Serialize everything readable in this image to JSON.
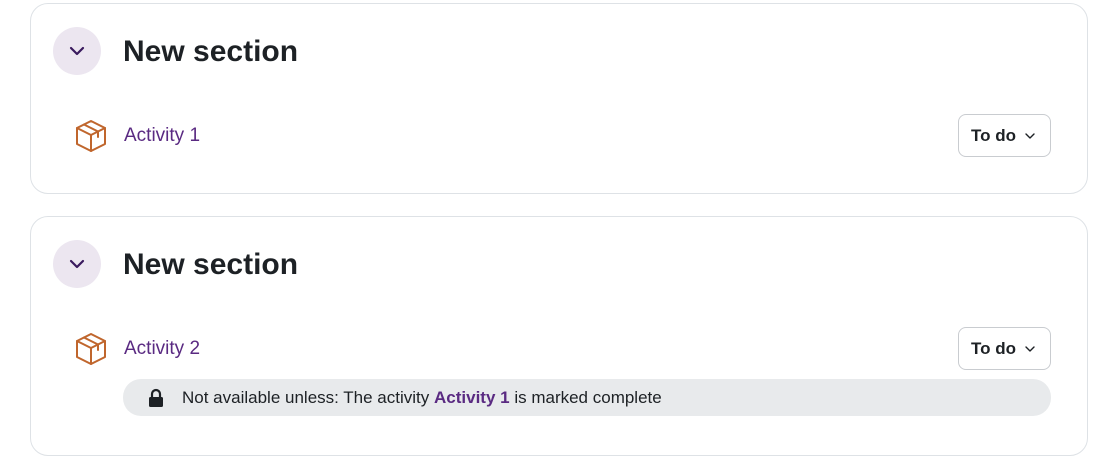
{
  "sections": [
    {
      "title": "New section",
      "activity": {
        "name": "Activity 1",
        "icon": "package-icon",
        "completion": "To do"
      }
    },
    {
      "title": "New section",
      "activity": {
        "name": "Activity 2",
        "icon": "package-icon",
        "completion": "To do"
      },
      "restriction": {
        "icon": "lock-icon",
        "prefix": "Not available unless: The activity",
        "link": "Activity 1",
        "suffix": "is marked complete"
      }
    }
  ],
  "colors": {
    "accent": "#5a2a82",
    "icon_orange": "#c0662d",
    "collapse_bg": "#ece6f0",
    "restriction_bg": "#e8eaec"
  }
}
